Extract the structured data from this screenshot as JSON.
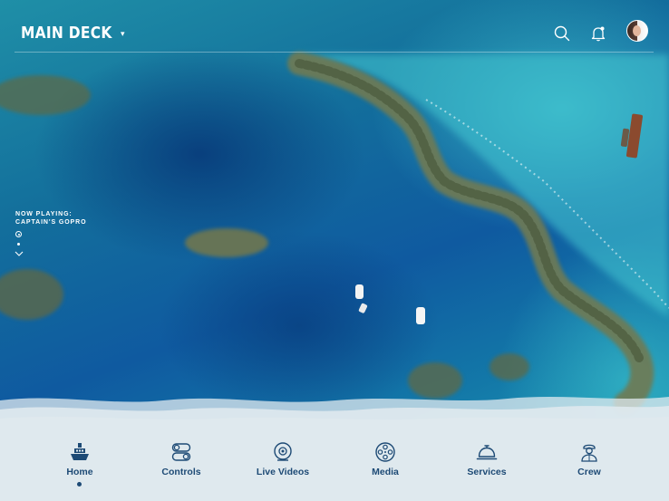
{
  "header": {
    "title": "MAIN DECK",
    "caret_icon": "caret-down-icon",
    "icons": [
      "search-icon",
      "bell-icon",
      "avatar"
    ]
  },
  "now_playing": {
    "line1": "NOW PLAYING:",
    "line2": "CAPTAIN'S GOPRO"
  },
  "nav": {
    "items": [
      {
        "label": "Home",
        "icon": "ship-icon",
        "active": true
      },
      {
        "label": "Controls",
        "icon": "toggles-icon",
        "active": false
      },
      {
        "label": "Live Videos",
        "icon": "camera-icon",
        "active": false
      },
      {
        "label": "Media",
        "icon": "film-reel-icon",
        "active": false
      },
      {
        "label": "Services",
        "icon": "service-bell-icon",
        "active": false
      },
      {
        "label": "Crew",
        "icon": "captain-icon",
        "active": false
      }
    ]
  },
  "colors": {
    "nav_background": "#dfe9ee",
    "nav_text": "#1d4a75",
    "header_text": "#ffffff"
  }
}
